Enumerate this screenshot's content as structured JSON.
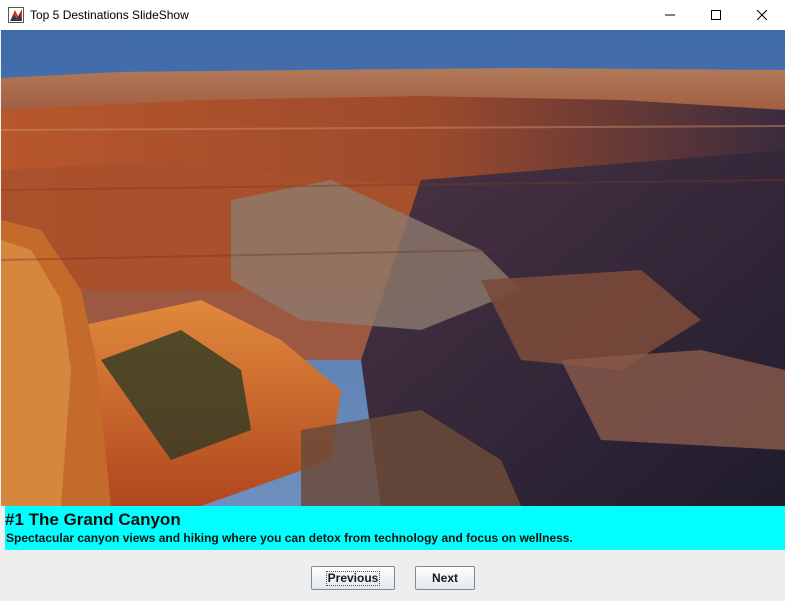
{
  "window": {
    "title": "Top 5 Destinations SlideShow",
    "icon": "java-app-icon",
    "controls": [
      "minimize-icon",
      "maximize-icon",
      "close-icon"
    ]
  },
  "slide": {
    "image": "grand-canyon-photo",
    "title": "#1 The Grand Canyon",
    "description": "Spectacular canyon views and hiking where you can detox from technology and focus on wellness."
  },
  "buttons": {
    "previous": "Previous",
    "next": "Next"
  },
  "colors": {
    "caption_background": "#00ffff",
    "window_background": "#f0f0f0"
  }
}
